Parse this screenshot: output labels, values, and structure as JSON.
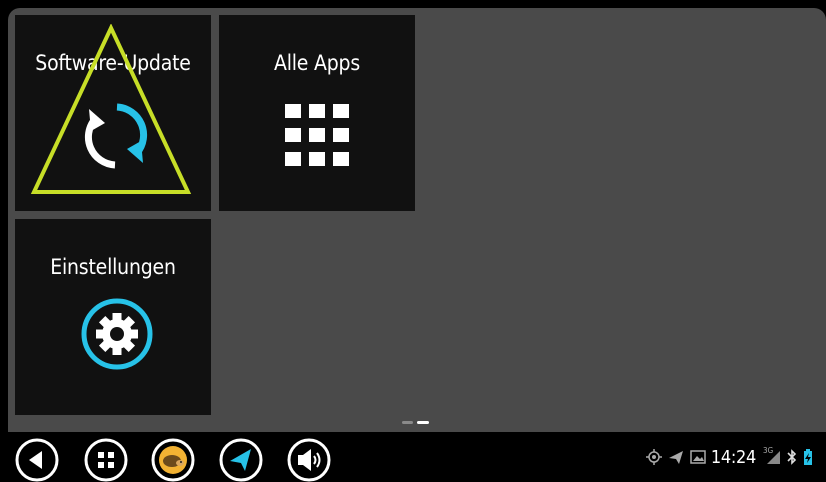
{
  "tiles": {
    "software_update": {
      "label": "Software-Update",
      "icon": "refresh-icon"
    },
    "all_apps": {
      "label": "Alle Apps",
      "icon": "app-grid-icon"
    },
    "settings": {
      "label": "Einstellungen",
      "icon": "gear-icon"
    }
  },
  "overlay": {
    "icon": "warning-triangle-icon",
    "color": "#c7de27"
  },
  "accent_color": "#27c2e8",
  "page_indicator": {
    "pages": 2,
    "current": 2
  },
  "navbar": {
    "buttons": [
      {
        "name": "back",
        "icon": "back-arrow-icon"
      },
      {
        "name": "apps",
        "icon": "app-grid-icon"
      },
      {
        "name": "app-hedgehog",
        "icon": "hedgehog-icon"
      },
      {
        "name": "navigation",
        "icon": "navigation-arrow-icon"
      },
      {
        "name": "volume",
        "icon": "speaker-icon"
      }
    ]
  },
  "status_bar": {
    "time": "14:24",
    "network": "3G",
    "icons": [
      "gps-icon",
      "navigation-arrow-icon",
      "image-icon",
      "signal-icon",
      "bluetooth-icon",
      "battery-charging-icon"
    ]
  }
}
